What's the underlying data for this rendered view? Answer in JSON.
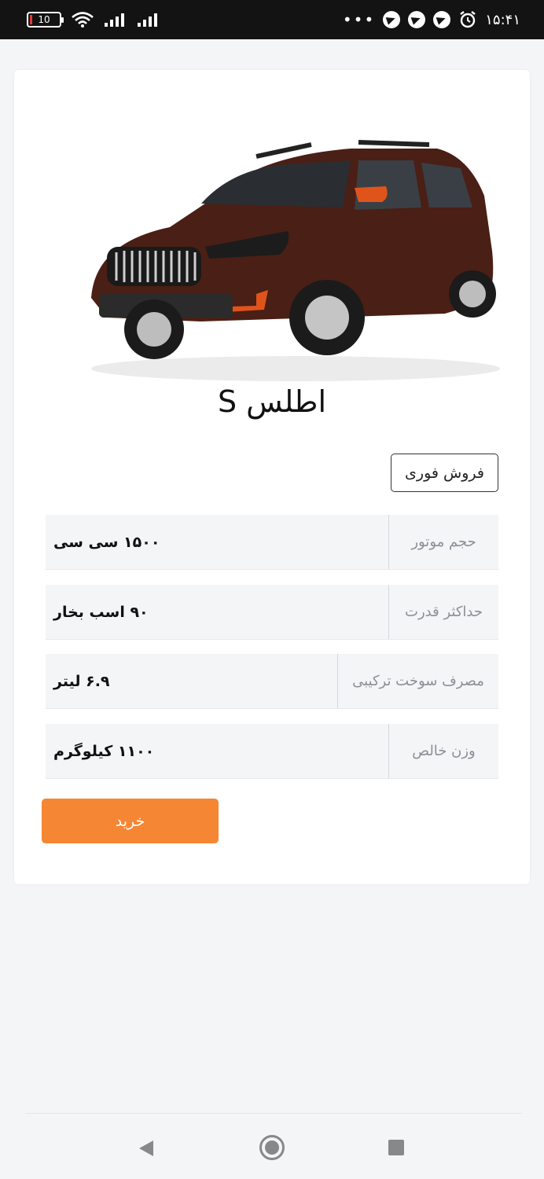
{
  "status_bar": {
    "battery": "10",
    "time": "۱۵:۴۱",
    "more": "•••"
  },
  "product": {
    "title": "اطلس S",
    "image_icon": "car-photo",
    "quick_sale_label": "فروش فوری",
    "buy_label": "خرید",
    "specs": [
      {
        "label": "حجم موتور",
        "value": "۱۵۰۰ سی سی"
      },
      {
        "label": "حداکثر قدرت",
        "value": "۹۰ اسب بخار"
      },
      {
        "label": "مصرف سوخت ترکیبی",
        "value": "۶.۹ لیتر"
      },
      {
        "label": "وزن خالص",
        "value": "۱۱۰۰ کیلوگرم"
      }
    ],
    "colors": {
      "accent": "#f58634",
      "car_body": "#4a1f15"
    }
  },
  "nav": {
    "back_icon": "back-icon",
    "home_icon": "home-icon",
    "recent_icon": "recent-apps-icon"
  }
}
